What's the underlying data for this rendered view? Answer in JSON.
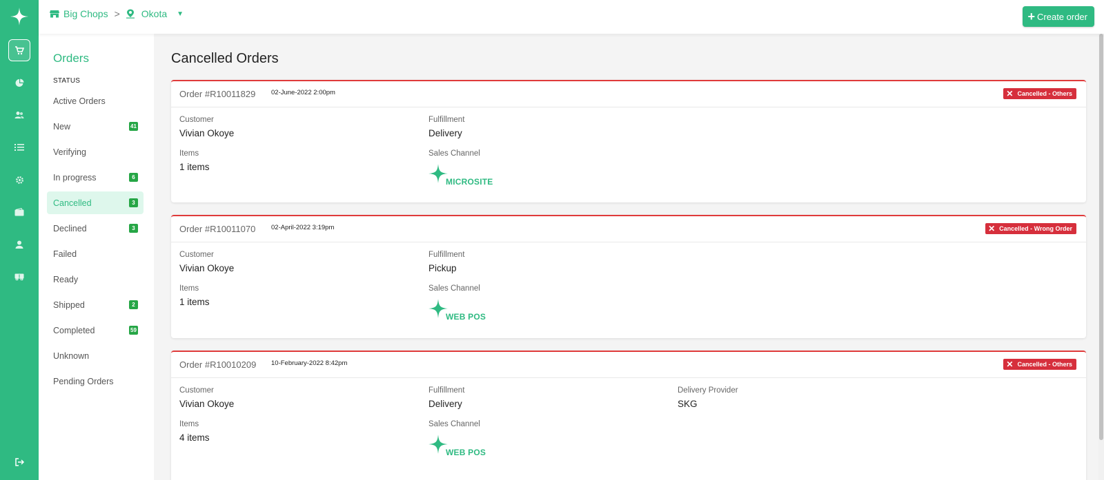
{
  "rail": {
    "items": [
      {
        "name": "rail-cart",
        "icon": "cart-icon",
        "active": true
      },
      {
        "name": "rail-analytics",
        "icon": "pie-chart-icon"
      },
      {
        "name": "rail-customers",
        "icon": "users-icon"
      },
      {
        "name": "rail-catalog",
        "icon": "list-icon"
      },
      {
        "name": "rail-settings",
        "icon": "gear-icon"
      },
      {
        "name": "rail-wallet",
        "icon": "wallet-icon"
      },
      {
        "name": "rail-profile",
        "icon": "user-icon"
      },
      {
        "name": "rail-delivery",
        "icon": "truck-icon"
      }
    ],
    "logout_icon": "logout-icon"
  },
  "header": {
    "store": "Big Chops",
    "location": "Okota",
    "create_button": "Create order"
  },
  "sidebar": {
    "title": "Orders",
    "status_label": "STATUS",
    "items": [
      {
        "label": "Active Orders",
        "count": ""
      },
      {
        "label": "New",
        "count": "41"
      },
      {
        "label": "Verifying",
        "count": ""
      },
      {
        "label": "In progress",
        "count": "6"
      },
      {
        "label": "Cancelled",
        "count": "3",
        "active": true
      },
      {
        "label": "Declined",
        "count": "3"
      },
      {
        "label": "Failed",
        "count": ""
      },
      {
        "label": "Ready",
        "count": ""
      },
      {
        "label": "Shipped",
        "count": "2"
      },
      {
        "label": "Completed",
        "count": "59"
      },
      {
        "label": "Unknown",
        "count": ""
      },
      {
        "label": "Pending Orders",
        "count": ""
      }
    ]
  },
  "main": {
    "title": "Cancelled Orders",
    "labels": {
      "customer": "Customer",
      "fulfillment": "Fulfillment",
      "items": "Items",
      "sales_channel": "Sales Channel",
      "delivery_provider": "Delivery Provider"
    },
    "orders": [
      {
        "number": "Order #R10011829",
        "date": "02-June-2022 2:00pm",
        "status": "Cancelled - Others",
        "customer": "Vivian Okoye",
        "fulfillment": "Delivery",
        "items": "1 items",
        "channel": "MICROSITE",
        "delivery_provider": ""
      },
      {
        "number": "Order #R10011070",
        "date": "02-April-2022 3:19pm",
        "status": "Cancelled - Wrong Order",
        "customer": "Vivian Okoye",
        "fulfillment": "Pickup",
        "items": "1 items",
        "channel": "WEB POS",
        "delivery_provider": ""
      },
      {
        "number": "Order #R10010209",
        "date": "10-February-2022 8:42pm",
        "status": "Cancelled - Others",
        "customer": "Vivian Okoye",
        "fulfillment": "Delivery",
        "items": "4 items",
        "channel": "WEB POS",
        "delivery_provider": "SKG"
      }
    ]
  },
  "colors": {
    "brand": "#2fba82",
    "cancel": "#d62f3c",
    "badge": "#26a646"
  }
}
